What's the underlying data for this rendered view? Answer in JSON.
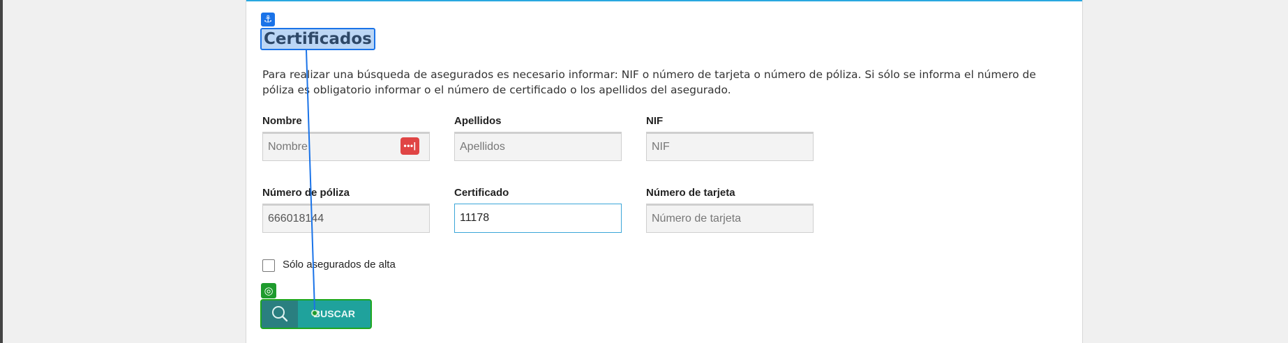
{
  "page": {
    "title": "Certificados",
    "info": "Para realizar una búsqueda de asegurados es necesario informar: NIF o número de tarjeta o número de póliza. Si sólo se informa el número de póliza es obligatorio informar o el número de certificado o los apellidos del asegurado."
  },
  "fields": {
    "nombre": {
      "label": "Nombre",
      "value": "",
      "placeholder": "Nombre"
    },
    "apellidos": {
      "label": "Apellidos",
      "value": "",
      "placeholder": "Apellidos"
    },
    "nif": {
      "label": "NIF",
      "value": "",
      "placeholder": "NIF"
    },
    "poliza": {
      "label": "Número de póliza",
      "value": "666018144",
      "placeholder": ""
    },
    "certificado": {
      "label": "Certificado",
      "value": "11178",
      "placeholder": ""
    },
    "tarjeta": {
      "label": "Número de tarjeta",
      "value": "",
      "placeholder": "Número de tarjeta"
    }
  },
  "checkbox": {
    "label": "Sólo asegurados de alta",
    "checked": false
  },
  "search_button": {
    "label": "BUSCAR"
  },
  "badges": {
    "anchor_icon": "anchor-icon",
    "target_icon": "target-icon",
    "password_icon": "password-manager-icon"
  },
  "colors": {
    "accent": "#29a8e0",
    "button": "#1fa29c",
    "highlight": "#1a73e8",
    "target": "#1e9b2d",
    "password": "#e04545"
  }
}
